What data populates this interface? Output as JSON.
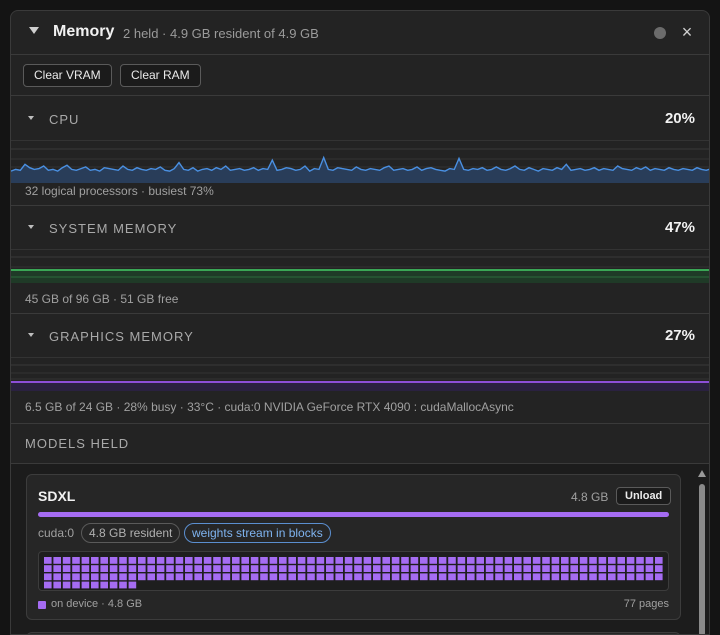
{
  "header": {
    "title": "Memory",
    "subtitle": "2 held · 4.9 GB resident of 4.9 GB"
  },
  "toolbar": {
    "clear_vram": "Clear VRAM",
    "clear_ram": "Clear RAM"
  },
  "sections": {
    "cpu": {
      "label": "CPU",
      "percent": "20%",
      "description": "32 logical processors · busiest 73%",
      "color": "#4a90e2",
      "series": [
        14,
        16,
        15,
        22,
        18,
        16,
        17,
        20,
        15,
        16,
        14,
        18,
        21,
        16,
        15,
        17,
        19,
        15,
        16,
        14,
        18,
        17,
        16,
        15,
        20,
        16,
        15,
        18,
        16,
        15,
        17,
        16,
        19,
        15,
        14,
        17,
        24,
        16,
        15,
        18,
        14,
        16,
        17,
        15,
        18,
        16,
        20,
        15,
        16,
        17,
        15,
        16,
        18,
        15,
        17,
        16,
        27,
        15,
        16,
        18,
        17,
        15,
        16,
        20,
        14,
        17,
        16,
        30,
        16,
        15,
        18,
        17,
        16,
        15,
        19,
        16,
        15,
        17,
        16,
        15,
        18,
        20,
        15,
        16,
        17,
        15,
        16,
        19,
        15,
        17,
        18,
        16,
        15,
        14,
        17,
        16,
        29,
        16,
        15,
        17,
        16,
        18,
        15,
        16,
        19,
        16,
        15,
        17,
        20,
        16,
        15,
        18,
        16,
        14,
        17,
        16,
        15,
        18,
        16,
        22,
        15,
        16,
        17,
        15,
        16,
        18,
        15,
        17,
        16,
        15,
        20,
        17,
        16,
        15,
        18,
        16,
        19,
        15,
        17,
        16,
        15,
        18,
        16,
        15,
        17,
        16,
        15,
        18,
        16,
        15,
        17
      ]
    },
    "system_memory": {
      "label": "SYSTEM MEMORY",
      "percent": "47%",
      "description": "45 GB of 96 GB · 51 GB free",
      "color": "#3aa655"
    },
    "graphics_memory": {
      "label": "GRAPHICS MEMORY",
      "percent": "27%",
      "description": "6.5 GB of 24 GB · 28% busy · 33°C · cuda:0 NVIDIA GeForce RTX 4090 : cudaMallocAsync",
      "color": "#8d4fd8"
    }
  },
  "models": {
    "label": "MODELS HELD",
    "items": [
      {
        "name": "SDXL",
        "size": "4.8 GB",
        "unload": "Unload",
        "device": "cuda:0",
        "resident": "4.8 GB resident",
        "stream": "weights stream in blocks",
        "progress": 1.0,
        "legend": "on device · 4.8 GB",
        "pages": "77 pages",
        "page_count": 77,
        "color": "#a56cf2"
      }
    ]
  }
}
